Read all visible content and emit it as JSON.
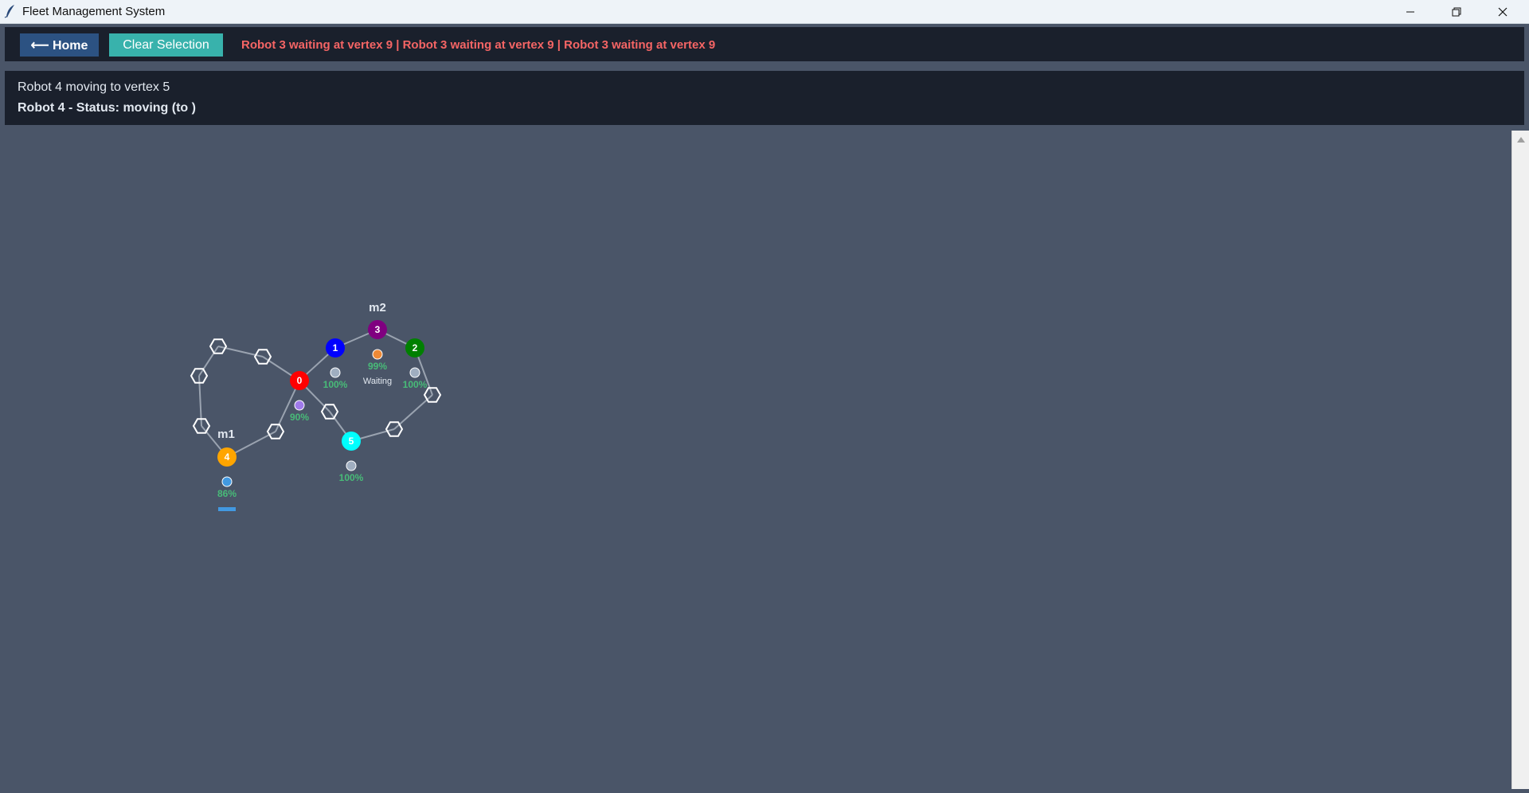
{
  "window": {
    "title": "Fleet Management System",
    "icon": "feather-icon",
    "controls": [
      "minimize-icon",
      "restore-icon",
      "close-icon"
    ]
  },
  "toolbar": {
    "home_label": "⟵ Home",
    "clear_label": "Clear Selection",
    "alert_text": "Robot 3 waiting at vertex 9 | Robot 3 waiting at vertex 9 | Robot 3 waiting at vertex 9",
    "alert_color": "#f56565",
    "home_color": "#2c5282",
    "clear_color": "#38b2ac"
  },
  "status": {
    "line1": "Robot 4 moving to vertex 5",
    "line2": "Robot 4 - Status: moving (to )"
  },
  "map": {
    "labels": [
      {
        "text": "m2"
      },
      {
        "text": "m1"
      }
    ],
    "robots": [
      {
        "id": "0",
        "color": "#ff0000",
        "indicator_color": "#9f7aea",
        "battery": "90%",
        "status": ""
      },
      {
        "id": "1",
        "color": "#0000ff",
        "indicator_color": "#a0aec0",
        "battery": "100%",
        "status": ""
      },
      {
        "id": "2",
        "color": "#008000",
        "indicator_color": "#a0aec0",
        "battery": "100%",
        "status": ""
      },
      {
        "id": "3",
        "color": "#800080",
        "indicator_color": "#ed8936",
        "battery": "99%",
        "status": "Waiting"
      },
      {
        "id": "4",
        "color": "#ffa500",
        "indicator_color": "#4299e1",
        "battery": "86%",
        "status": ""
      },
      {
        "id": "5",
        "color": "#00ffff",
        "indicator_color": "#a0aec0",
        "battery": "100%",
        "status": ""
      }
    ],
    "battery_color": "#48bb78"
  }
}
